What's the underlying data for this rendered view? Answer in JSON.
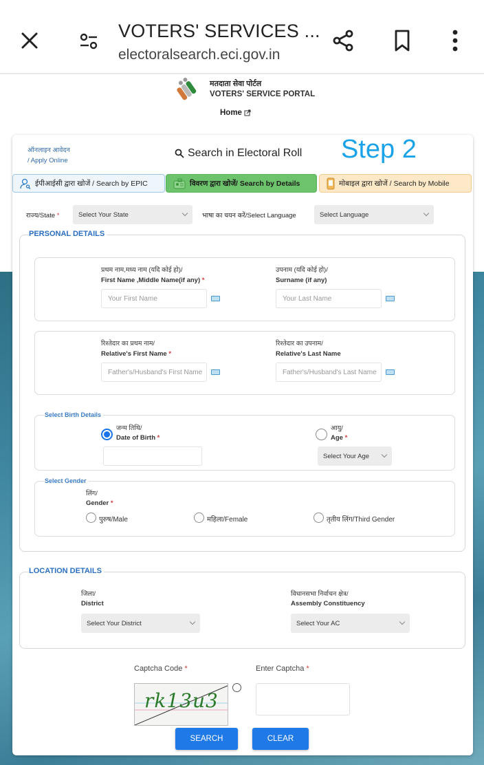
{
  "browser": {
    "title": "VOTERS' SERVICES ...",
    "url": "electoralsearch.eci.gov.in",
    "icons": {
      "close": "close-icon",
      "tune": "site-settings-icon",
      "share": "share-icon",
      "bookmark": "bookmark-icon",
      "more": "more-vert-icon"
    }
  },
  "site": {
    "title_hi": "मतदाता सेवा पोर्टल",
    "title_en": "VOTERS' SERVICE PORTAL",
    "home_link": "Home"
  },
  "card": {
    "apply_online_hi": "ऑनलाइन आवेदन",
    "apply_online_en": "/ Apply Online",
    "search_title": "Search in Electoral Roll",
    "step_label": "Step 2",
    "tabs": [
      {
        "label": "ईपीआईसी द्वारा खोजें / Search by EPIC",
        "active": false,
        "color": "#eef5fb"
      },
      {
        "label": "विवरण द्वारा खोजें/ Search by Details",
        "active": true,
        "color": "#6cc36b"
      },
      {
        "label": "मोबाइल द्वारा खोजें / Search by Mobile",
        "active": false,
        "color": "#fde9c7"
      }
    ],
    "state_label": "राज्य/State",
    "state_select": "Select Your State",
    "language_label": "भाषा का चयन करें/Select Language",
    "language_select": "Select Language"
  },
  "personal": {
    "legend": "PERSONAL DETAILS",
    "first_name_hi": "प्रथम नाम,मध्य नाम (यदि कोई हो)/",
    "first_name_en": "First Name ,Middle Name(if any)",
    "first_name_placeholder": "Your First Name",
    "surname_hi": "उपनाम (यदि कोई हो)/",
    "surname_en": "Surname (if any)",
    "surname_placeholder": "Your Last Name",
    "rel_first_hi": "रिश्तेदार का प्रथम नाम/",
    "rel_first_en": "Relative's First Name",
    "rel_first_placeholder": "Father's/Husband's First Name",
    "rel_last_hi": "रिश्तेदार का उपनाम/",
    "rel_last_en": "Relative's Last Name",
    "rel_last_placeholder": "Father's/Husband's Last Name",
    "birth_legend": "Select Birth Details",
    "dob_hi": "जन्म तिथि/",
    "dob_en": "Date of Birth",
    "dob_value": "",
    "dob_selected": true,
    "age_hi": "आयु/",
    "age_en": "Age",
    "age_select": "Select Your Age",
    "gender_legend": "Select Gender",
    "gender_hi": "लिंग/",
    "gender_en": "Gender",
    "gender_options": [
      "पुरुष/Male",
      "महिला/Female",
      "तृतीय लिंग/Third Gender"
    ]
  },
  "location": {
    "legend": "LOCATION DETAILS",
    "district_hi": "जिला/",
    "district_en": "District",
    "district_select": "Select Your District",
    "ac_hi": "विधानसभा निर्वाचन क्षेत्र/",
    "ac_en": "Assembly Constituency",
    "ac_select": "Select Your AC"
  },
  "captcha": {
    "code_label": "Captcha Code",
    "enter_label": "Enter Captcha",
    "image_text": "rk13u3",
    "input_value": ""
  },
  "buttons": {
    "search": "SEARCH",
    "clear": "CLEAR"
  },
  "colors": {
    "accent_blue": "#1f7ae8",
    "legend_blue": "#2a6ec0",
    "step_cyan": "#1aa3e8",
    "required_red": "#d23a3a"
  }
}
